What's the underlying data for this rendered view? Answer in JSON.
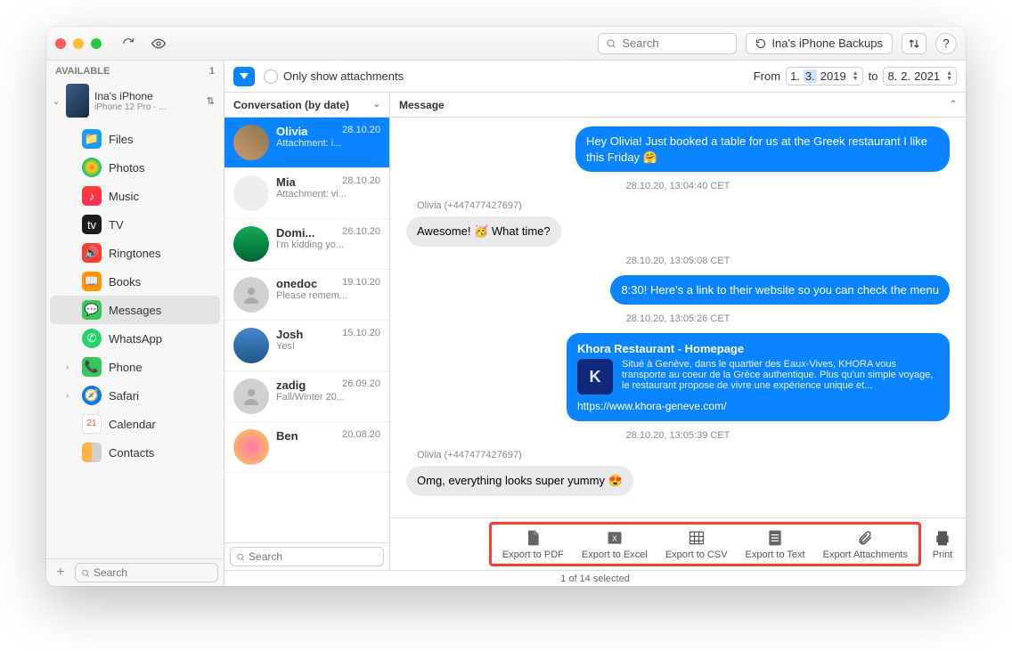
{
  "titlebar": {
    "search_placeholder": "Search",
    "backup_label": "Ina's iPhone Backups",
    "help_label": "?"
  },
  "sidebar": {
    "header_label": "AVAILABLE",
    "header_count": "1",
    "device": {
      "name": "Ina's iPhone",
      "model": "iPhone 12 Pro - ..."
    },
    "items": [
      {
        "label": "Files"
      },
      {
        "label": "Photos"
      },
      {
        "label": "Music"
      },
      {
        "label": "TV"
      },
      {
        "label": "Ringtones"
      },
      {
        "label": "Books"
      },
      {
        "label": "Messages"
      },
      {
        "label": "WhatsApp"
      },
      {
        "label": "Phone"
      },
      {
        "label": "Safari"
      },
      {
        "label": "Calendar"
      },
      {
        "label": "Contacts"
      }
    ],
    "search_placeholder": "Search"
  },
  "filter": {
    "only_attachments": "Only show attachments",
    "from_label": "From",
    "to_label": "to",
    "date_from_d": "1.",
    "date_from_m": "3.",
    "date_from_y": "2019",
    "date_to_d": "8.",
    "date_to_m": "2.",
    "date_to_y": "2021"
  },
  "conv_header": "Conversation (by date)",
  "msg_header": "Message",
  "conversations": [
    {
      "name": "Olivia",
      "date": "28.10.20",
      "sub": "Attachment: i..."
    },
    {
      "name": "Mia",
      "date": "28.10.20",
      "sub": "Attachment: vi..."
    },
    {
      "name": "Domi...",
      "date": "26.10.20",
      "sub": "I'm kidding yo..."
    },
    {
      "name": "onedoc",
      "date": "19.10.20",
      "sub": "Please remem..."
    },
    {
      "name": "Josh",
      "date": "15.10.20",
      "sub": "Yes!"
    },
    {
      "name": "zadig",
      "date": "26.09.20",
      "sub": "Fall/Winter 20..."
    },
    {
      "name": "Ben",
      "date": "20.08.20",
      "sub": ""
    }
  ],
  "conv_search_placeholder": "Search",
  "messages": {
    "m1": "Hey Olivia! Just booked a table for us at the Greek restaurant I like this Friday 🤗",
    "ts1": "28.10.20, 13:04:40 CET",
    "sender1": "Olivia (+447477427697)",
    "m2": "Awesome! 🥳 What time?",
    "ts2": "28.10.20, 13:05:08 CET",
    "m3": "8:30! Here's a link to their website so you can check the menu",
    "ts3": "28.10.20, 13:05:26 CET",
    "link_title": "Khora Restaurant - Homepage",
    "link_desc": "Situé à Genève, dans le quartier des Eaux-Vives, KHORA vous transporte au coeur de la Grèce authentique. Plus qu'un simple voyage, le restaurant propose de vivre une expérience unique et...",
    "link_url": "https://www.khora-geneve.com/",
    "link_logo": "K",
    "ts4": "28.10.20, 13:05:39 CET",
    "sender2": "Olivia (+447477427697)",
    "m4": "Omg, everything looks super yummy 😍"
  },
  "export": {
    "pdf": "Export to PDF",
    "excel": "Export to Excel",
    "csv": "Export to CSV",
    "text": "Export to Text",
    "att": "Export Attachments"
  },
  "print_label": "Print",
  "status": "1 of 14 selected"
}
